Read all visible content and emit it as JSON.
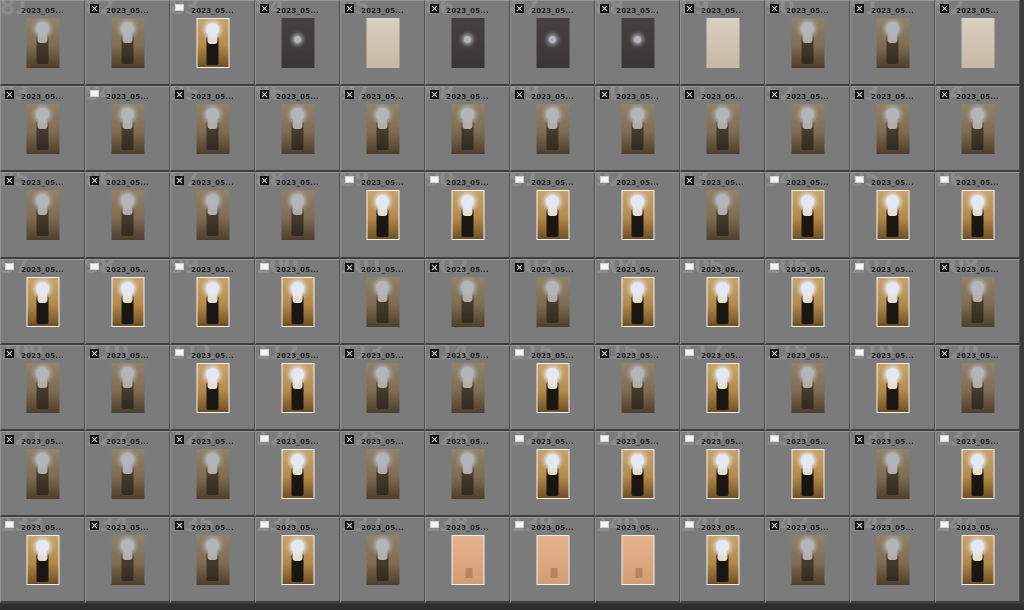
{
  "grid": {
    "columns": 12,
    "cells": [
      {
        "index": "81",
        "filename": "2023_05...",
        "flag": "none",
        "style": "dim"
      },
      {
        "index": "82",
        "filename": "2023_05...",
        "flag": "rejected",
        "style": "dim"
      },
      {
        "index": "83",
        "filename": "2023_05...",
        "flag": "picked",
        "style": "picked"
      },
      {
        "index": "84",
        "filename": "2023_05...",
        "flag": "rejected",
        "style": "dark"
      },
      {
        "index": "85",
        "filename": "2023_05...",
        "flag": "rejected",
        "style": "light"
      },
      {
        "index": "86",
        "filename": "2023_05...",
        "flag": "rejected",
        "style": "dark"
      },
      {
        "index": "87",
        "filename": "2023_05...",
        "flag": "rejected",
        "style": "dark"
      },
      {
        "index": "88",
        "filename": "2023_05...",
        "flag": "rejected",
        "style": "dark"
      },
      {
        "index": "89",
        "filename": "2023_05...",
        "flag": "rejected",
        "style": "light"
      },
      {
        "index": "90",
        "filename": "2023_05...",
        "flag": "rejected",
        "style": "dim"
      },
      {
        "index": "91",
        "filename": "2023_05...",
        "flag": "rejected",
        "style": "dim"
      },
      {
        "index": "92",
        "filename": "2023_05...",
        "flag": "rejected",
        "style": "light"
      },
      {
        "index": "93",
        "filename": "2023_05...",
        "flag": "rejected",
        "style": "dim"
      },
      {
        "index": "94",
        "filename": "2023_05...",
        "flag": "picked",
        "style": "dim"
      },
      {
        "index": "95",
        "filename": "2023_05...",
        "flag": "rejected",
        "style": "dim"
      },
      {
        "index": "96",
        "filename": "2023_05...",
        "flag": "rejected",
        "style": "dim"
      },
      {
        "index": "97",
        "filename": "2023_05...",
        "flag": "rejected",
        "style": "dim"
      },
      {
        "index": "98",
        "filename": "2023_05...",
        "flag": "rejected",
        "style": "dim"
      },
      {
        "index": "99",
        "filename": "2023_05...",
        "flag": "rejected",
        "style": "dim"
      },
      {
        "index": "50",
        "filename": "2023_05...",
        "flag": "rejected",
        "style": "dim"
      },
      {
        "index": "51",
        "filename": "2023_05...",
        "flag": "rejected",
        "style": "dim"
      },
      {
        "index": "52",
        "filename": "2023_05...",
        "flag": "rejected",
        "style": "dim"
      },
      {
        "index": "53",
        "filename": "2023_05...",
        "flag": "rejected",
        "style": "dim"
      },
      {
        "index": "54",
        "filename": "2023_05...",
        "flag": "rejected",
        "style": "dim"
      },
      {
        "index": "85",
        "filename": "2023_05...",
        "flag": "rejected",
        "style": "dim"
      },
      {
        "index": "86",
        "filename": "2023_05...",
        "flag": "rejected",
        "style": "dim"
      },
      {
        "index": "87",
        "filename": "2023_05...",
        "flag": "rejected",
        "style": "dim"
      },
      {
        "index": "88",
        "filename": "2023_05...",
        "flag": "rejected",
        "style": "dim"
      },
      {
        "index": "89",
        "filename": "2023_05...",
        "flag": "picked",
        "style": "picked"
      },
      {
        "index": "90",
        "filename": "2023_05...",
        "flag": "picked",
        "style": "picked"
      },
      {
        "index": "91",
        "filename": "2023_05...",
        "flag": "picked",
        "style": "picked"
      },
      {
        "index": "92",
        "filename": "2023_05...",
        "flag": "picked",
        "style": "picked"
      },
      {
        "index": "93",
        "filename": "2023_05...",
        "flag": "rejected",
        "style": "dim"
      },
      {
        "index": "94",
        "filename": "2023_05...",
        "flag": "picked",
        "style": "picked"
      },
      {
        "index": "95",
        "filename": "2023_05...",
        "flag": "picked",
        "style": "picked"
      },
      {
        "index": "96",
        "filename": "2023_05...",
        "flag": "picked",
        "style": "picked"
      },
      {
        "index": "97",
        "filename": "2023_05...",
        "flag": "picked",
        "style": "picked"
      },
      {
        "index": "98",
        "filename": "2023_05...",
        "flag": "picked",
        "style": "picked"
      },
      {
        "index": "99",
        "filename": "2023_05...",
        "flag": "picked",
        "style": "picked"
      },
      {
        "index": "100",
        "filename": "2023_05...",
        "flag": "picked",
        "style": "picked"
      },
      {
        "index": "101",
        "filename": "2023_05...",
        "flag": "rejected",
        "style": "dim"
      },
      {
        "index": "102",
        "filename": "2023_05...",
        "flag": "rejected",
        "style": "dim"
      },
      {
        "index": "103",
        "filename": "2023_05...",
        "flag": "rejected",
        "style": "dim"
      },
      {
        "index": "104",
        "filename": "2023_05...",
        "flag": "picked",
        "style": "picked"
      },
      {
        "index": "105",
        "filename": "2023_05...",
        "flag": "picked",
        "style": "picked"
      },
      {
        "index": "106",
        "filename": "2023_05...",
        "flag": "picked",
        "style": "picked"
      },
      {
        "index": "107",
        "filename": "2023_05...",
        "flag": "picked",
        "style": "picked"
      },
      {
        "index": "108",
        "filename": "2023_05...",
        "flag": "rejected",
        "style": "dim"
      },
      {
        "index": "109",
        "filename": "2023_05...",
        "flag": "rejected",
        "style": "dim"
      },
      {
        "index": "110",
        "filename": "2023_05...",
        "flag": "rejected",
        "style": "dim"
      },
      {
        "index": "111",
        "filename": "2023_05...",
        "flag": "picked",
        "style": "picked"
      },
      {
        "index": "112",
        "filename": "2023_05...",
        "flag": "picked",
        "style": "picked"
      },
      {
        "index": "113",
        "filename": "2023_05...",
        "flag": "rejected",
        "style": "dim"
      },
      {
        "index": "114",
        "filename": "2023_05...",
        "flag": "rejected",
        "style": "dim"
      },
      {
        "index": "115",
        "filename": "2023_05...",
        "flag": "picked",
        "style": "picked"
      },
      {
        "index": "116",
        "filename": "2023_05...",
        "flag": "rejected",
        "style": "dim"
      },
      {
        "index": "117",
        "filename": "2023_05...",
        "flag": "picked",
        "style": "picked"
      },
      {
        "index": "118",
        "filename": "2023_05...",
        "flag": "rejected",
        "style": "dim"
      },
      {
        "index": "119",
        "filename": "2023_05...",
        "flag": "picked",
        "style": "picked"
      },
      {
        "index": "120",
        "filename": "2023_05...",
        "flag": "rejected",
        "style": "dim"
      },
      {
        "index": "121",
        "filename": "2023_05...",
        "flag": "rejected",
        "style": "dim"
      },
      {
        "index": "122",
        "filename": "2023_05...",
        "flag": "rejected",
        "style": "dim"
      },
      {
        "index": "123",
        "filename": "2023_05...",
        "flag": "rejected",
        "style": "dim"
      },
      {
        "index": "124",
        "filename": "2023_05...",
        "flag": "picked",
        "style": "picked"
      },
      {
        "index": "125",
        "filename": "2023_05...",
        "flag": "rejected",
        "style": "dim"
      },
      {
        "index": "126",
        "filename": "2023_05...",
        "flag": "rejected",
        "style": "dim"
      },
      {
        "index": "127",
        "filename": "2023_05...",
        "flag": "picked",
        "style": "picked"
      },
      {
        "index": "128",
        "filename": "2023_05...",
        "flag": "picked",
        "style": "picked"
      },
      {
        "index": "129",
        "filename": "2023_05...",
        "flag": "picked",
        "style": "picked"
      },
      {
        "index": "130",
        "filename": "2023_05...",
        "flag": "picked",
        "style": "picked"
      },
      {
        "index": "131",
        "filename": "2023_05...",
        "flag": "rejected",
        "style": "dim"
      },
      {
        "index": "132",
        "filename": "2023_05...",
        "flag": "picked",
        "style": "picked"
      },
      {
        "index": "133",
        "filename": "2023_05...",
        "flag": "picked",
        "style": "picked"
      },
      {
        "index": "134",
        "filename": "2023_05...",
        "flag": "rejected",
        "style": "dim"
      },
      {
        "index": "135",
        "filename": "2023_05...",
        "flag": "rejected",
        "style": "dim"
      },
      {
        "index": "136",
        "filename": "2023_05...",
        "flag": "picked",
        "style": "picked"
      },
      {
        "index": "137",
        "filename": "2023_05...",
        "flag": "rejected",
        "style": "dim"
      },
      {
        "index": "138",
        "filename": "2023_05...",
        "flag": "picked",
        "style": "peach"
      },
      {
        "index": "139",
        "filename": "2023_05...",
        "flag": "picked",
        "style": "peach"
      },
      {
        "index": "140",
        "filename": "2023_05...",
        "flag": "picked",
        "style": "peach"
      },
      {
        "index": "141",
        "filename": "2023_05...",
        "flag": "picked",
        "style": "picked"
      },
      {
        "index": "142",
        "filename": "2023_05...",
        "flag": "rejected",
        "style": "dim"
      },
      {
        "index": "143",
        "filename": "2023_05...",
        "flag": "rejected",
        "style": "dim"
      },
      {
        "index": "144",
        "filename": "2023_05...",
        "flag": "picked",
        "style": "picked"
      }
    ]
  }
}
